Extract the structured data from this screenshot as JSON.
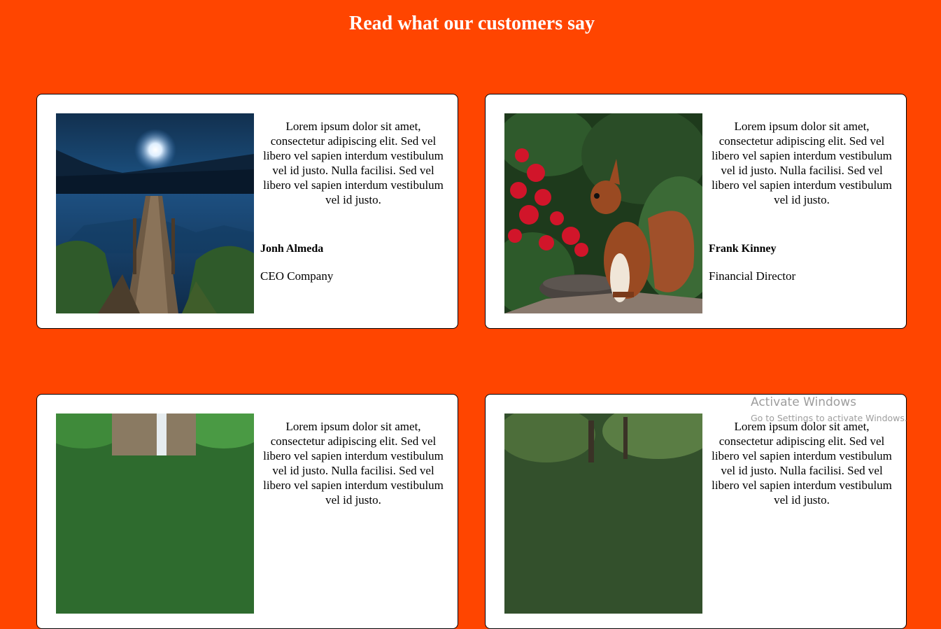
{
  "header": {
    "title": "Read what our customers say"
  },
  "testimonials": [
    {
      "quote": "Lorem ipsum dolor sit amet, consectetur adipiscing elit. Sed vel libero vel sapien interdum vestibulum vel id justo. Nulla facilisi. Sed vel libero vel sapien interdum vestibulum vel id justo.",
      "name": "Jonh Almeda",
      "role": "CEO Company",
      "image": "lake-dock-night-photo"
    },
    {
      "quote": "Lorem ipsum dolor sit amet, consectetur adipiscing elit. Sed vel libero vel sapien interdum vestibulum vel id justo. Nulla facilisi. Sed vel libero vel sapien interdum vestibulum vel id justo.",
      "name": "Frank Kinney",
      "role": "Financial Director",
      "image": "squirrel-flowers-photo"
    },
    {
      "quote": "Lorem ipsum dolor sit amet, consectetur adipiscing elit. Sed vel libero vel sapien interdum vestibulum vel id justo. Nulla facilisi. Sed vel libero vel sapien interdum vestibulum vel id justo.",
      "name": "",
      "role": "",
      "image": "waterfall-forest-photo"
    },
    {
      "quote": "Lorem ipsum dolor sit amet, consectetur adipiscing elit. Sed vel libero vel sapien interdum vestibulum vel id justo. Nulla facilisi. Sed vel libero vel sapien interdum vestibulum vel id justo.",
      "name": "",
      "role": "",
      "image": "forest-trees-photo"
    }
  ],
  "os_watermark": {
    "title": "Activate Windows",
    "subtitle": "Go to Settings to activate Windows."
  },
  "colors": {
    "background": "#ff4500",
    "card": "#ffffff",
    "title": "#ffffff"
  }
}
